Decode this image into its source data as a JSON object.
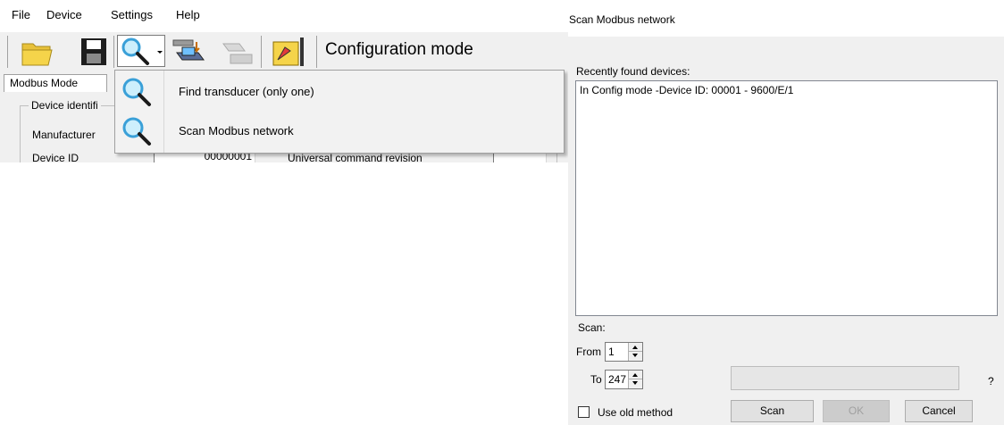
{
  "app": {
    "menu": [
      "File",
      "Device",
      "Settings",
      "Help"
    ],
    "mode_label": "Configuration mode",
    "tabs": [
      "Modbus Mode"
    ],
    "group_title": "Device identifi",
    "fields": {
      "manufacturer_label": "Manufacturer",
      "device_id_label": "Device ID",
      "device_id_value": "00000001",
      "right_label": "Universal command revision"
    },
    "search_menu": [
      {
        "label": "Find transducer (only one)",
        "icon": "magnifier-icon"
      },
      {
        "label": "Scan Modbus network",
        "icon": "magnifier-icon"
      }
    ]
  },
  "dialog": {
    "title": "Scan Modbus network",
    "devices_label": "Recently found devices:",
    "devices": [
      "In Config mode -Device ID: 00001 - 9600/E/1"
    ],
    "scan_label": "Scan:",
    "from_label": "From",
    "from_value": "1",
    "to_label": "To",
    "to_value": "247",
    "help_symbol": "?",
    "use_old_method_label": "Use old method",
    "use_old_method_checked": false,
    "buttons": {
      "scan": "Scan",
      "ok": "OK",
      "cancel": "Cancel"
    }
  },
  "colors": {
    "accent": "#0078d7",
    "panel": "#f0f0f0",
    "folder": "#f5d44a"
  }
}
